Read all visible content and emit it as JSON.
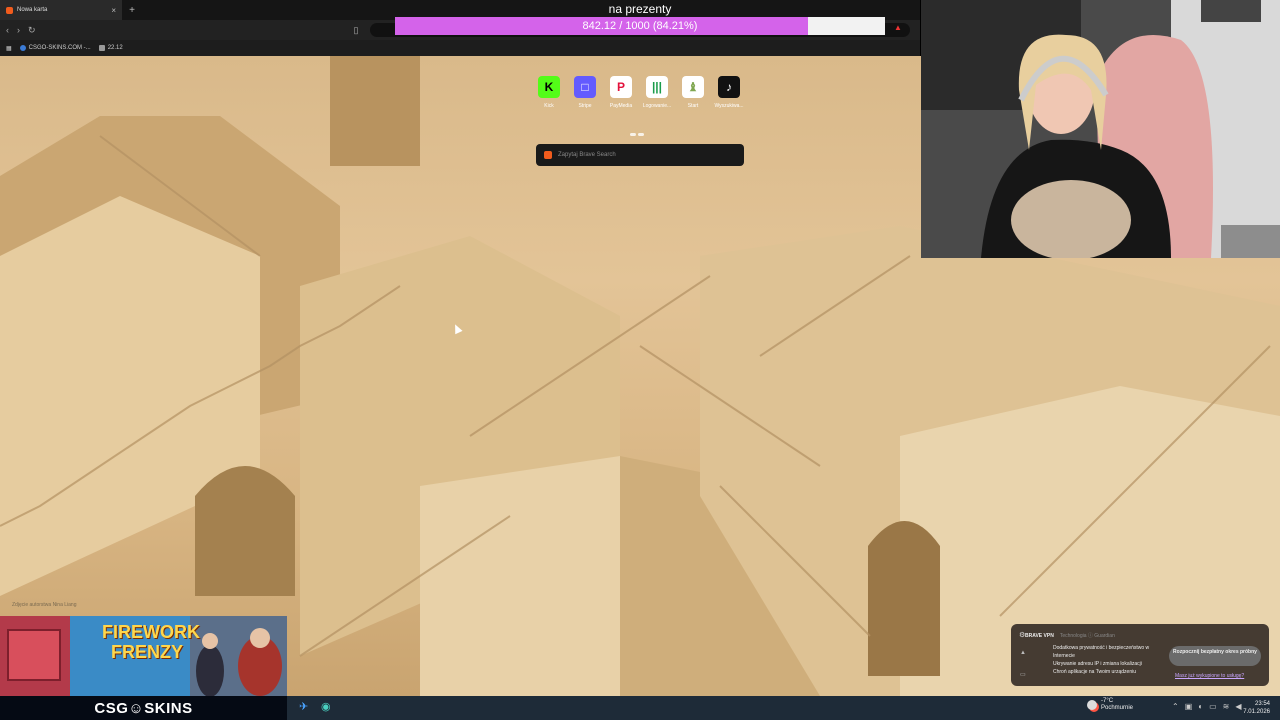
{
  "browser": {
    "tab_title": "Nowa karta",
    "new_tab_symbol": "+",
    "bookmarks": [
      {
        "label": "CSGO-SKINS.COM -..."
      },
      {
        "label": "22.12"
      }
    ]
  },
  "goal": {
    "title": "na prezenty",
    "progress_text": "842.12 / 1000 (84.21%)",
    "fraction": 0.8421,
    "fill_color": "#d463ea"
  },
  "newtab": {
    "shortcuts": [
      {
        "label": "Kick",
        "icon": "kick-icon",
        "glyph": "K",
        "color": "#53fc18",
        "fg": "#000"
      },
      {
        "label": "Stripe",
        "icon": "stripe-icon",
        "glyph": "□",
        "color": "#635bff",
        "fg": "#fff"
      },
      {
        "label": "PayMedia",
        "icon": "paymedia-icon",
        "glyph": "P",
        "color": "#ffffff",
        "fg": "#e3123c"
      },
      {
        "label": "Logowanie...",
        "icon": "bars-icon",
        "glyph": "|||",
        "color": "#ffffff",
        "fg": "#1a9c4b"
      },
      {
        "label": "Start",
        "icon": "chess-icon",
        "glyph": "♝",
        "color": "#ffffff",
        "fg": "#7fa650"
      },
      {
        "label": "Wyszukiwa...",
        "icon": "tiktok-icon",
        "glyph": "♪",
        "color": "#111111",
        "fg": "#fff"
      }
    ],
    "search_placeholder": "Zapytaj Brave Search",
    "photo_credit": "Zdjęcie autorstwa Nina Liang"
  },
  "banner": {
    "title_line1": "FIREWORK",
    "title_line2": "FRENZY"
  },
  "sponsor": {
    "logo_text": "CSG☺SKINS"
  },
  "taskbar": {
    "weather_temp": "-7°C",
    "weather_desc": "Pochmurnie",
    "time": "23:54",
    "date": "7.01.2026"
  },
  "vpn_popup": {
    "brand": "BRAVE VPN",
    "tagline": "Technologia ⓘ Guardian",
    "features": [
      "Dodatkowa prywatność i bezpieczeństwo w Internecie",
      "Ukrywanie adresu IP i zmiana lokalizacji",
      "Chroń aplikacje na Twoim urządzeniu"
    ],
    "cta_label": "Rozpocznij bezpłatny okres próbny",
    "link_label": "Masz już wykupione to usługę?"
  }
}
